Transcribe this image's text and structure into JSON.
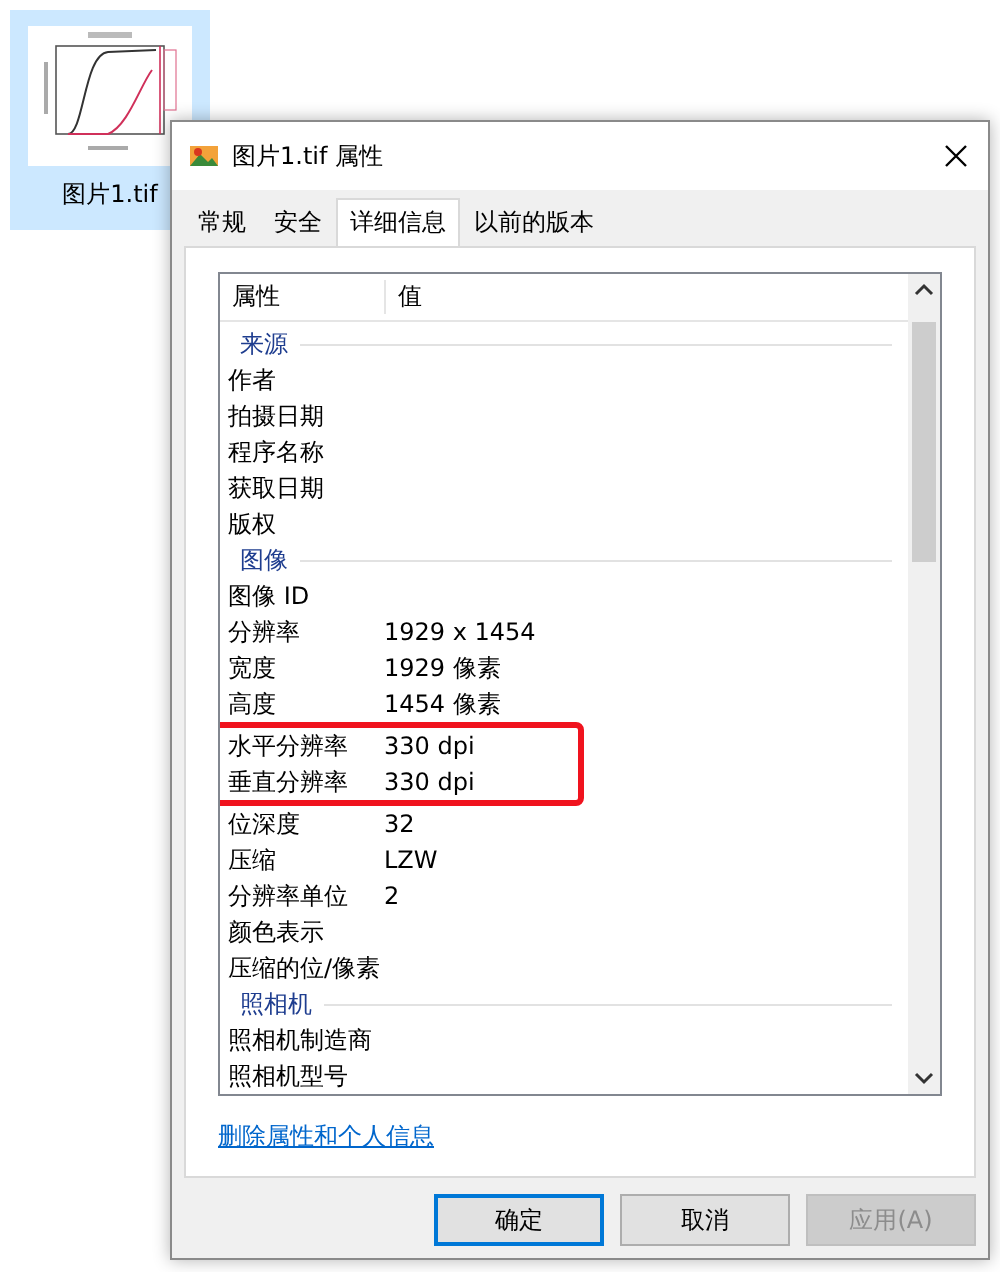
{
  "desktop_icon": {
    "label": "图片1.tif",
    "selected": true
  },
  "window": {
    "title": "图片1.tif 属性",
    "tabs": [
      {
        "label": "常规",
        "selected": false
      },
      {
        "label": "安全",
        "selected": false
      },
      {
        "label": "详细信息",
        "selected": true
      },
      {
        "label": "以前的版本",
        "selected": false
      }
    ],
    "columns": [
      "属性",
      "值"
    ],
    "rows": [
      {
        "kind": "group",
        "label": "来源"
      },
      {
        "kind": "property",
        "name": "作者",
        "highlighted": false
      },
      {
        "kind": "property",
        "name": "拍摄日期",
        "highlighted": false
      },
      {
        "kind": "property",
        "name": "程序名称",
        "highlighted": false
      },
      {
        "kind": "property",
        "name": "获取日期",
        "highlighted": false
      },
      {
        "kind": "property",
        "name": "版权",
        "highlighted": false
      },
      {
        "kind": "group",
        "label": "图像"
      },
      {
        "kind": "property",
        "name": "图像 ID",
        "highlighted": false
      },
      {
        "kind": "property",
        "name": "分辨率",
        "value": "1929 x 1454",
        "highlighted": false
      },
      {
        "kind": "property",
        "name": "宽度",
        "value": "1929 像素",
        "highlighted": false
      },
      {
        "kind": "property",
        "name": "高度",
        "value": "1454 像素",
        "highlighted": false
      },
      {
        "kind": "property",
        "name": "水平分辨率",
        "value": "330 dpi",
        "highlighted": true
      },
      {
        "kind": "property",
        "name": "垂直分辨率",
        "value": "330 dpi",
        "highlighted": true
      },
      {
        "kind": "property",
        "name": "位深度",
        "value": "32",
        "highlighted": false
      },
      {
        "kind": "property",
        "name": "压缩",
        "value": "LZW",
        "highlighted": false
      },
      {
        "kind": "property",
        "name": "分辨率单位",
        "value": "2",
        "highlighted": false
      },
      {
        "kind": "property",
        "name": "颜色表示",
        "highlighted": false
      },
      {
        "kind": "property",
        "name": "压缩的位/像素",
        "highlighted": false
      },
      {
        "kind": "group",
        "label": "照相机"
      },
      {
        "kind": "property",
        "name": "照相机制造商",
        "highlighted": false
      },
      {
        "kind": "property",
        "name": "照相机型号",
        "highlighted": false
      }
    ],
    "link": "删除属性和个人信息",
    "buttons": [
      {
        "label": "确定",
        "default": true,
        "disabled": false
      },
      {
        "label": "取消",
        "default": false,
        "disabled": false
      },
      {
        "label": "应用(A)",
        "default": false,
        "disabled": true
      }
    ]
  }
}
